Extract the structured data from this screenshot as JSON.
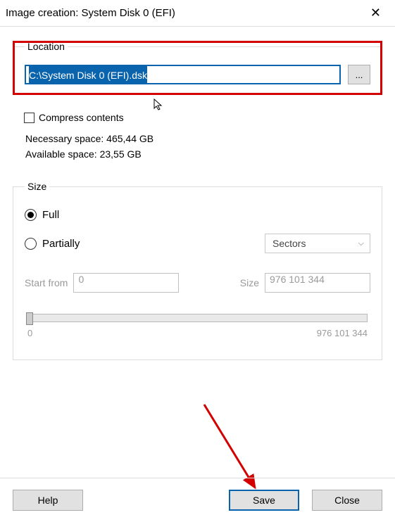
{
  "title": "Image creation: System Disk 0 (EFI)",
  "location": {
    "legend": "Location",
    "path": "C:\\System Disk 0 (EFI).dsk",
    "browse": "...",
    "compress_label": "Compress contents",
    "necessary_label": "Necessary space: 465,44 GB",
    "available_label": "Available space: 23,55 GB"
  },
  "size": {
    "legend": "Size",
    "full_label": "Full",
    "partial_label": "Partially",
    "unit_selected": "Sectors",
    "start_label": "Start from",
    "start_value": "0",
    "size_label": "Size",
    "size_value": "976 101 344",
    "slider_min": "0",
    "slider_max": "976 101 344"
  },
  "buttons": {
    "help": "Help",
    "save": "Save",
    "close": "Close"
  }
}
